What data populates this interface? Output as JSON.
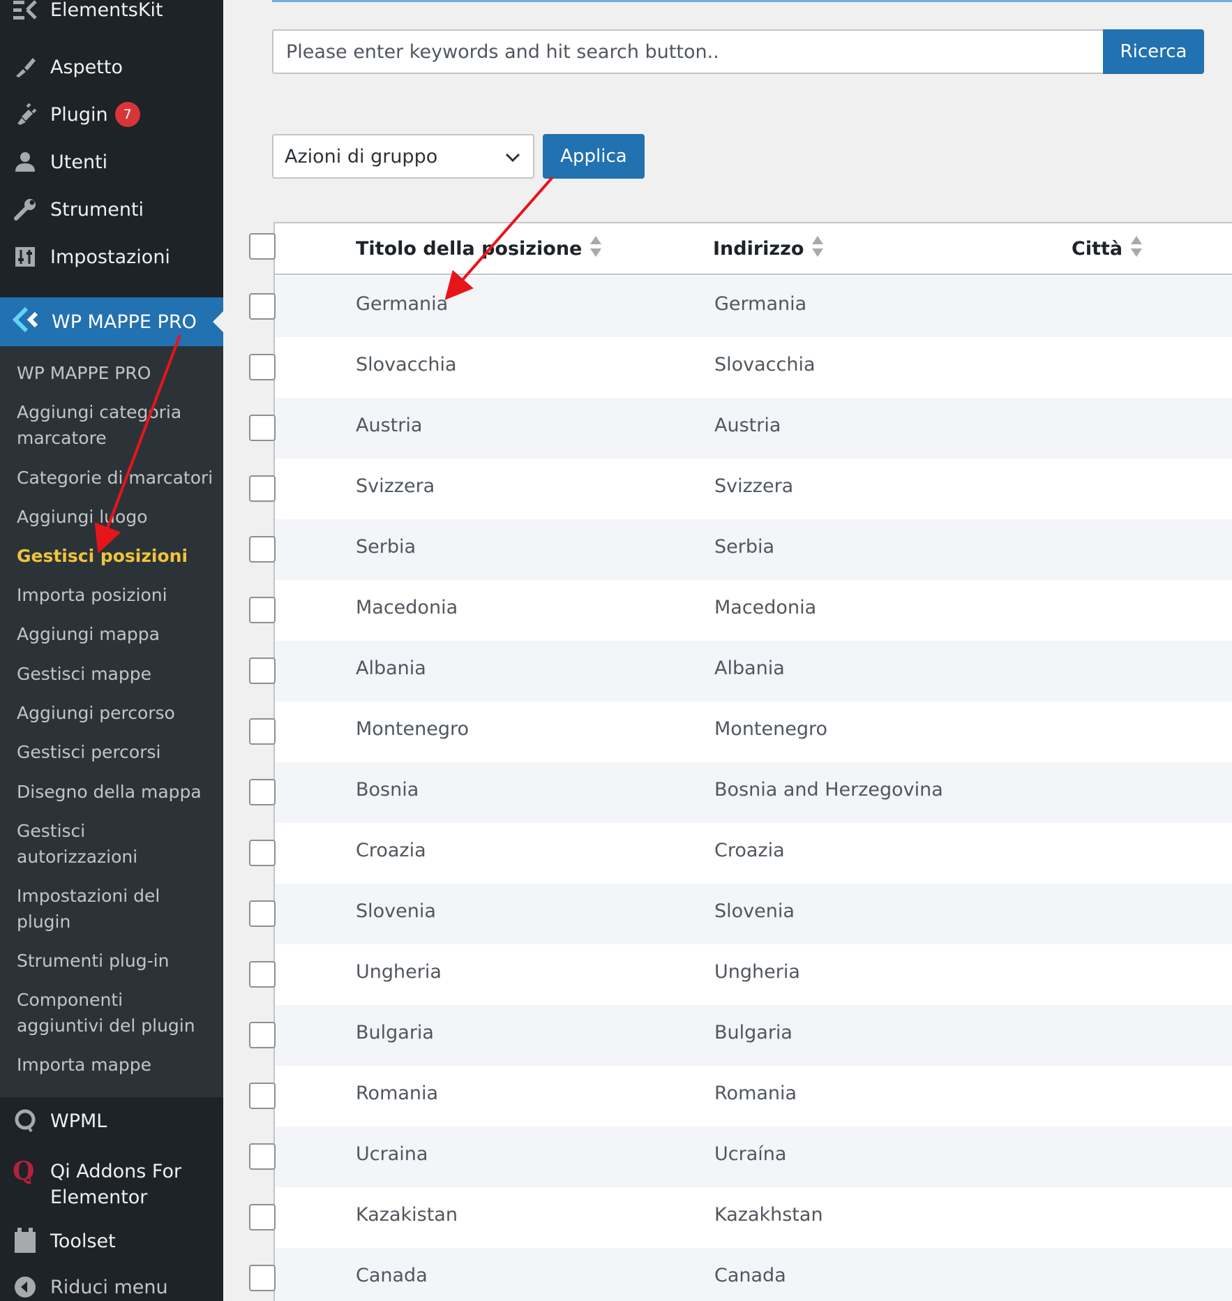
{
  "sidebar": {
    "top_items": [
      {
        "label": "ElementsKit",
        "icon": "elementskit-icon"
      },
      {
        "label": "Aspetto",
        "icon": "paintbrush-icon"
      },
      {
        "label": "Plugin",
        "icon": "plugin-icon",
        "badge": "7"
      },
      {
        "label": "Utenti",
        "icon": "user-icon"
      },
      {
        "label": "Strumenti",
        "icon": "wrench-icon"
      },
      {
        "label": "Impostazioni",
        "icon": "settings-sliders-icon"
      }
    ],
    "active_menu": {
      "label": "WP MAPPE PRO",
      "icon": "wp-mappe-pro-logo-icon"
    },
    "submenu": [
      {
        "label": "WP MAPPE PRO"
      },
      {
        "label": "Aggiungi categoria marcatore"
      },
      {
        "label": "Categorie di marcatori"
      },
      {
        "label": "Aggiungi luogo"
      },
      {
        "label": "Gestisci posizioni",
        "current": true
      },
      {
        "label": "Importa posizioni"
      },
      {
        "label": "Aggiungi mappa"
      },
      {
        "label": "Gestisci mappe"
      },
      {
        "label": "Aggiungi percorso"
      },
      {
        "label": "Gestisci percorsi"
      },
      {
        "label": "Disegno della mappa"
      },
      {
        "label": "Gestisci autorizzazioni"
      },
      {
        "label": "Impostazioni del plugin"
      },
      {
        "label": "Strumenti plug-in"
      },
      {
        "label": "Componenti aggiuntivi del plugin"
      },
      {
        "label": "Importa mappe"
      }
    ],
    "bottom_items": [
      {
        "label": "WPML",
        "icon": "wpml-icon"
      },
      {
        "label": "Qi Addons For Elementor",
        "icon": "qi-addons-icon"
      },
      {
        "label": "Toolset",
        "icon": "toolset-icon"
      },
      {
        "label": "Riduci menu",
        "icon": "collapse-menu-icon"
      }
    ]
  },
  "search": {
    "placeholder": "Please enter keywords and hit search button..",
    "button_label": "Ricerca"
  },
  "bulk_actions": {
    "selected": "Azioni di gruppo",
    "apply_label": "Applica"
  },
  "table": {
    "columns": [
      "Titolo della posizione",
      "Indirizzo",
      "Città"
    ],
    "rows": [
      {
        "title": "Germania",
        "address": "Germania"
      },
      {
        "title": "Slovacchia",
        "address": "Slovacchia"
      },
      {
        "title": "Austria",
        "address": "Austria"
      },
      {
        "title": "Svizzera",
        "address": "Svizzera"
      },
      {
        "title": "Serbia",
        "address": "Serbia"
      },
      {
        "title": "Macedonia",
        "address": "Macedonia"
      },
      {
        "title": "Albania",
        "address": "Albania"
      },
      {
        "title": "Montenegro",
        "address": "Montenegro"
      },
      {
        "title": "Bosnia",
        "address": "Bosnia and Herzegovina"
      },
      {
        "title": "Croazia",
        "address": "Croazia"
      },
      {
        "title": "Slovenia",
        "address": "Slovenia"
      },
      {
        "title": "Ungheria",
        "address": "Ungheria"
      },
      {
        "title": "Bulgaria",
        "address": "Bulgaria"
      },
      {
        "title": "Romania",
        "address": "Romania"
      },
      {
        "title": "Ucraina",
        "address": "Ucraína"
      },
      {
        "title": "Kazakistan",
        "address": "Kazakhstan"
      },
      {
        "title": "Canada",
        "address": "Canada"
      }
    ]
  },
  "colors": {
    "sidebar_bg": "#1d2327",
    "submenu_bg": "#2c3338",
    "accent": "#2271b1",
    "current_submenu": "#f0c33c",
    "badge": "#d63638",
    "annotation_arrow": "#e8141c"
  }
}
